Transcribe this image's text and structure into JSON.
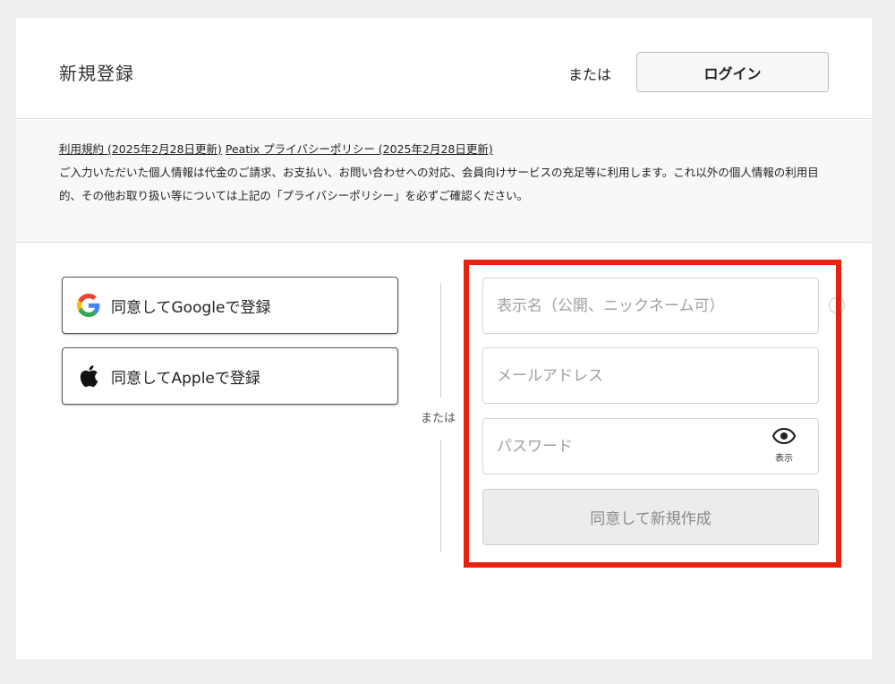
{
  "header": {
    "title": "新規登録",
    "or_text": "または",
    "login_label": "ログイン"
  },
  "notice": {
    "terms_link": "利用規約 (2025年2月28日更新)",
    "privacy_link": "Peatix プライバシーポリシー (2025年2月28日更新)",
    "body": "ご入力いただいた個人情報は代金のご請求、お支払い、お問い合わせへの対応、会員向けサービスの充足等に利用します。これ以外の個人情報の利用目的、その他お取り扱い等については上記の「プライバシーポリシー」を必ずご確認ください。"
  },
  "social": {
    "google_label": "同意してGoogleで登録",
    "apple_label": "同意してAppleで登録",
    "google_icon": "google-logo-icon",
    "apple_icon": "apple-logo-icon"
  },
  "divider": {
    "text": "または"
  },
  "form": {
    "name_placeholder": "表示名（公開、ニックネーム可）",
    "email_placeholder": "メールアドレス",
    "password_placeholder": "パスワード",
    "show_password_label": "表示",
    "submit_label": "同意して新規作成",
    "info_icon": "i"
  },
  "colors": {
    "highlight": "#e8220f",
    "google_blue": "#4285F4",
    "google_red": "#EA4335",
    "google_yellow": "#FBBC05",
    "google_green": "#34A853"
  }
}
